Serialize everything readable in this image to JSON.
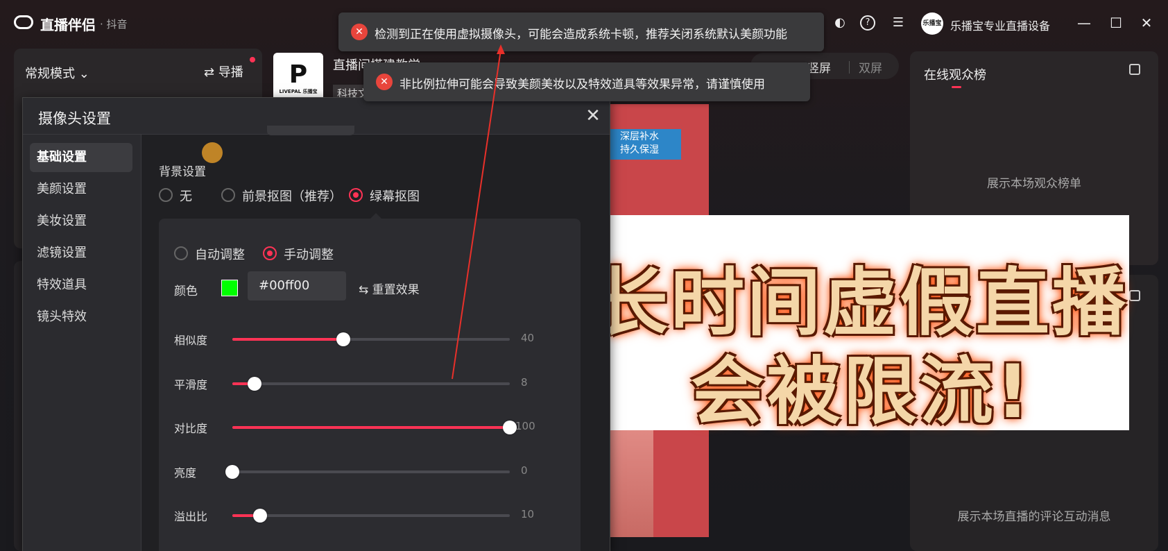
{
  "titlebar": {
    "app_name": "直播伴侣",
    "platform": "· 抖音",
    "user_name": "乐播宝专业直播设备",
    "avatar_text": "乐播宝"
  },
  "left_panel": {
    "mode": "常规模式 ⌄",
    "guide": "⇄ 导播"
  },
  "stream": {
    "logo_text": "P",
    "logo_caption": "LIVEPAL 乐播宝",
    "title": "直播间搭建教学 ",
    "subtitle": "科技文"
  },
  "screen_toggle": {
    "portrait": "竖屏",
    "dual": "双屏"
  },
  "notifications": [
    {
      "text": "检测到正在使用虚拟摄像头，可能会造成系统卡顿，推荐关闭系统默认美颜功能"
    },
    {
      "text": "非比例拉伸可能会导致美颜美妆以及特效道具等效果异常，请谨慎使用"
    }
  ],
  "right_panel": {
    "title": "在线观众榜",
    "empty": "展示本场观众榜单",
    "comments_empty": "展示本场直播的评论互动消息"
  },
  "preview": {
    "badge": "深层补水\n持久保湿"
  },
  "banner": {
    "line1": "长时间虚假直播",
    "line2": "会被限流!"
  },
  "dialog": {
    "title": "摄像头设置",
    "nav": [
      "基础设置",
      "美颜设置",
      "美妆设置",
      "滤镜设置",
      "特效道具",
      "镜头特效"
    ],
    "bg_label": "背景设置",
    "bg_options": [
      "无",
      "前景抠图（推荐）",
      "绿幕抠图"
    ],
    "adjust_options": [
      "自动调整",
      "手动调整"
    ],
    "color_label": "颜色",
    "color_hex": "#00ff00",
    "reset_label": "⇆ 重置效果",
    "sliders": [
      {
        "label": "相似度",
        "value": 40,
        "max": 100
      },
      {
        "label": "平滑度",
        "value": 8,
        "max": 100
      },
      {
        "label": "对比度",
        "value": 100,
        "max": 100
      },
      {
        "label": "亮度",
        "value": 0,
        "max": 100
      },
      {
        "label": "溢出比",
        "value": 10,
        "max": 100
      }
    ]
  },
  "colors": {
    "accent": "#ff3355",
    "key_color": "#00ff00",
    "error": "#e8453c"
  }
}
